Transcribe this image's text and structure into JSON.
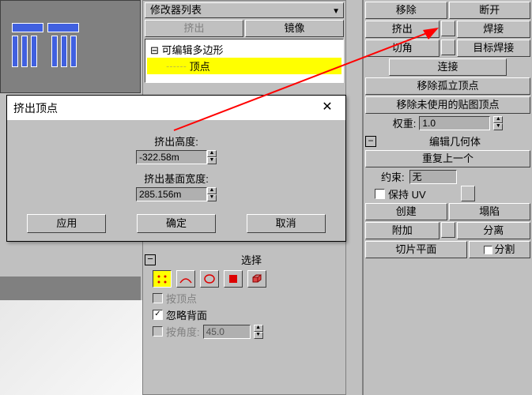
{
  "right": {
    "row1": {
      "remove": "移除",
      "break": "断开"
    },
    "row2": {
      "extrude": "挤出",
      "weld": "焊接"
    },
    "row3": {
      "chamfer": "切角",
      "target_weld": "目标焊接"
    },
    "connect": "连接",
    "remove_isolated": "移除孤立顶点",
    "remove_unused": "移除未使用的贴图顶点",
    "weight_label": "权重:",
    "weight_value": "1.0",
    "edit_geo_hdr": "编辑几何体",
    "repeat_last": "重复上一个",
    "constraint_label": "约束:",
    "constraint_value": "无",
    "keep_uv": "保持 UV",
    "create": "创建",
    "collapse": "塌陷",
    "attach": "附加",
    "detach": "分离",
    "slice_plane": "切片平面",
    "split": "分割"
  },
  "mid": {
    "modifier_list": "修改器列表",
    "extrude_btn": "挤出",
    "mirror_btn": "镜像",
    "tree_root": "可编辑多边形",
    "tree_vertex": "顶点",
    "sel_hdr": "选择",
    "by_vertex": "按顶点",
    "ignore_backface": "忽略背面",
    "by_angle": "按角度:",
    "angle_value": "45.0"
  },
  "dialog": {
    "title": "挤出顶点",
    "height_label": "挤出高度:",
    "height_value": "-322.58m",
    "width_label": "挤出基面宽度:",
    "width_value": "285.156m",
    "apply": "应用",
    "ok": "确定",
    "cancel": "取消"
  }
}
